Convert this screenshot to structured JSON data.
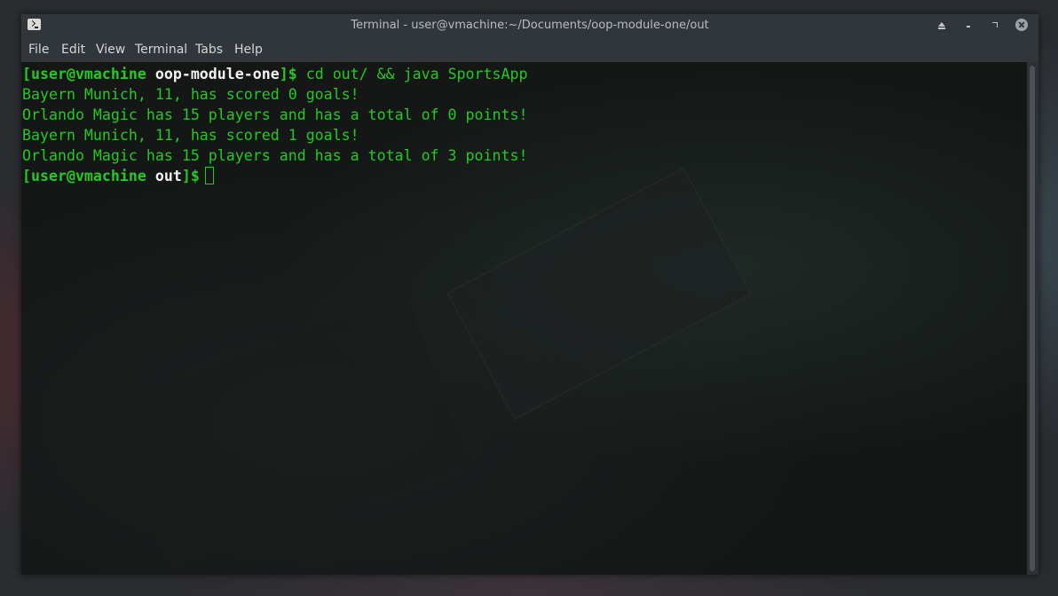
{
  "window": {
    "title": "Terminal - user@vmachine:~/Documents/oop-module-one/out"
  },
  "menubar": {
    "items": [
      "File",
      "Edit",
      "View",
      "Terminal",
      "Tabs",
      "Help"
    ]
  },
  "terminal": {
    "lines": [
      {
        "prompt_open": "[user@vmachine ",
        "prompt_dir": "oop-module-one",
        "prompt_close": "]$ ",
        "command": "cd out/ && java SportsApp"
      },
      {
        "output": "Bayern Munich, 11, has scored 0 goals!"
      },
      {
        "output": "Orlando Magic has 15 players and has a total of 0 points!"
      },
      {
        "output": "Bayern Munich, 11, has scored 1 goals!"
      },
      {
        "output": "Orlando Magic has 15 players and has a total of 3 points!"
      },
      {
        "prompt_open": "[user@vmachine ",
        "prompt_dir": "out",
        "prompt_close": "]$",
        "command": ""
      }
    ],
    "text_color": "#24c924"
  }
}
